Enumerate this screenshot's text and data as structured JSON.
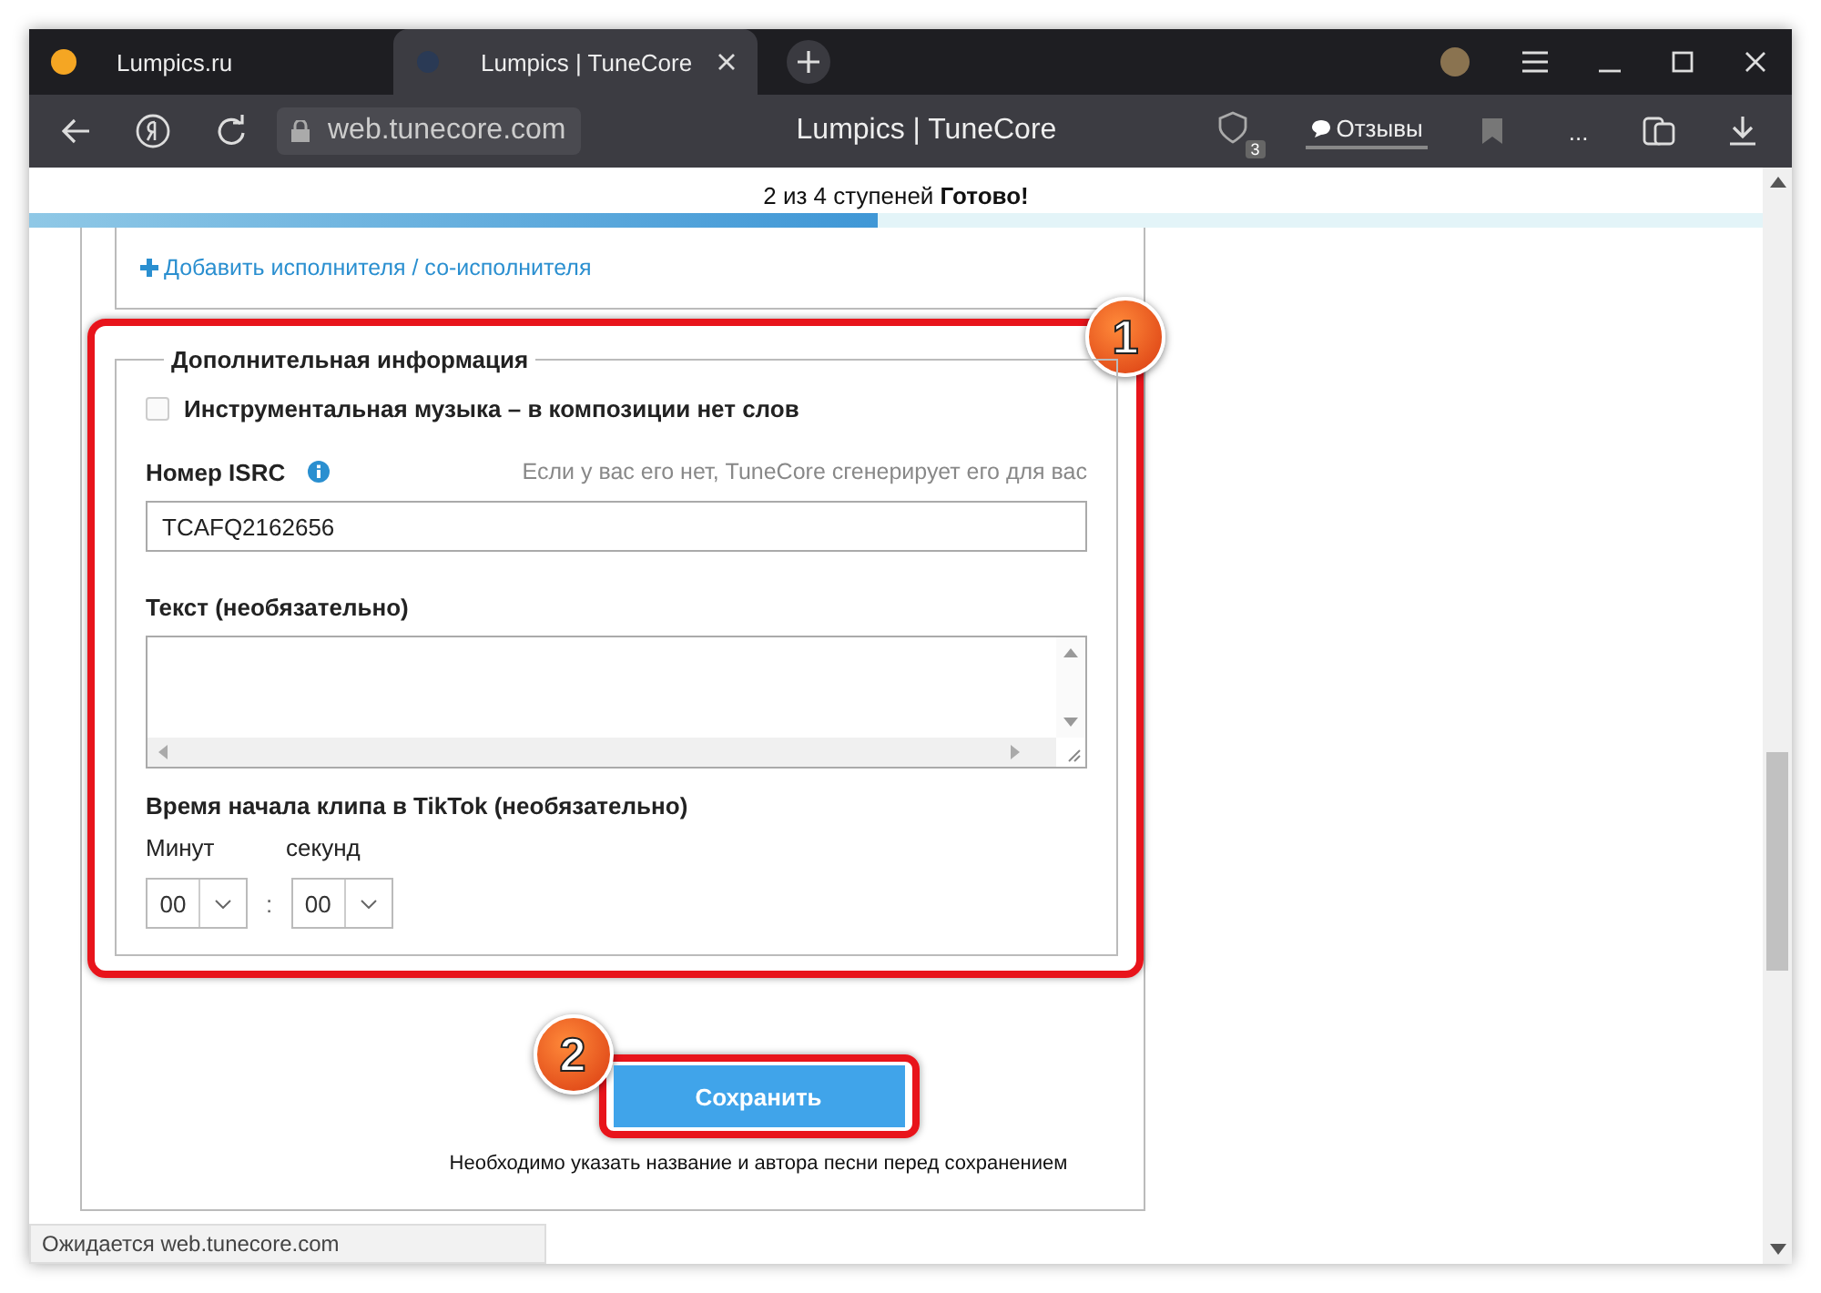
{
  "browser": {
    "tabs": [
      {
        "title": "Lumpics.ru",
        "selected": false
      },
      {
        "title": "Lumpics | TuneCore",
        "selected": true
      }
    ],
    "address": "web.tunecore.com",
    "page_title": "Lumpics | TuneCore",
    "badge_count": "3",
    "reviews_label": "Отзывы",
    "more_label": "..."
  },
  "progress": {
    "text": "2 из 4 ступеней",
    "done": "Готово!",
    "level": 0.49
  },
  "add_artist_link": "Добавить исполнителя / со-исполнителя",
  "section": {
    "legend": "Дополнительная информация",
    "instrumental": {
      "label": "Инструментальная музыка – в композиции нет слов",
      "checked": false
    },
    "isrc": {
      "label": "Номер ISRC",
      "hint": "Если у вас его нет, TuneCore сгенерирует его для вас",
      "value": "TCAFQ2162656"
    },
    "lyrics": {
      "label": "Текст (необязательно)"
    },
    "tiktok": {
      "label": "Время начала клипа в TikTok (необязательно)",
      "minutes_label": "Минут",
      "seconds_label": "секунд",
      "minutes": "00",
      "seconds": "00",
      "separator": ":"
    }
  },
  "save_button": "Сохранить",
  "save_note": "Необходимо указать название и автора песни перед сохранением",
  "annotations": [
    {
      "number": "1"
    },
    {
      "number": "2"
    }
  ],
  "status_text": "Ожидается web.tunecore.com"
}
